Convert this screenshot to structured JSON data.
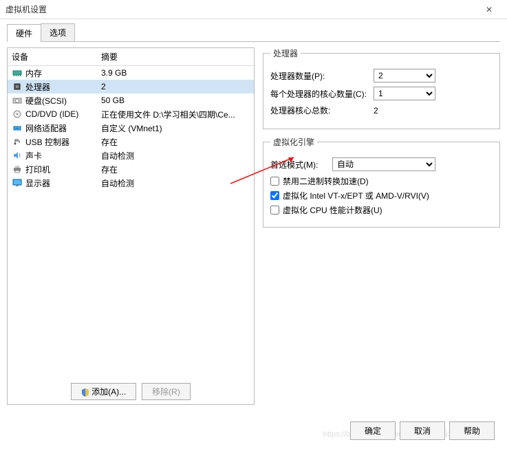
{
  "window": {
    "title": "虚拟机设置"
  },
  "tabs": {
    "hardware": "硬件",
    "options": "选项"
  },
  "device_table": {
    "col_device": "设备",
    "col_summary": "摘要"
  },
  "devices": [
    {
      "icon": "memory-icon",
      "name": "内存",
      "summary": "3.9 GB",
      "selected": false
    },
    {
      "icon": "cpu-icon",
      "name": "处理器",
      "summary": "2",
      "selected": true
    },
    {
      "icon": "disk-icon",
      "name": "硬盘(SCSI)",
      "summary": "50 GB",
      "selected": false
    },
    {
      "icon": "cd-icon",
      "name": "CD/DVD (IDE)",
      "summary": "正在使用文件 D:\\学习相关\\四期\\Ce...",
      "selected": false
    },
    {
      "icon": "net-icon",
      "name": "网络适配器",
      "summary": "自定义 (VMnet1)",
      "selected": false
    },
    {
      "icon": "usb-icon",
      "name": "USB 控制器",
      "summary": "存在",
      "selected": false
    },
    {
      "icon": "sound-icon",
      "name": "声卡",
      "summary": "自动检测",
      "selected": false
    },
    {
      "icon": "printer-icon",
      "name": "打印机",
      "summary": "存在",
      "selected": false
    },
    {
      "icon": "display-icon",
      "name": "显示器",
      "summary": "自动检测",
      "selected": false
    }
  ],
  "left_buttons": {
    "add": "添加(A)...",
    "remove": "移除(R)"
  },
  "processor": {
    "legend": "处理器",
    "count_label": "处理器数量(P):",
    "count_value": "2",
    "cores_label": "每个处理器的核心数量(C):",
    "cores_value": "1",
    "total_label": "处理器核心总数:",
    "total_value": "2"
  },
  "virtualization": {
    "legend": "虚拟化引擎",
    "mode_label": "首选模式(M):",
    "mode_value": "自动",
    "cb1": {
      "label": "禁用二进制转换加速(D)",
      "checked": false
    },
    "cb2": {
      "label": "虚拟化 Intel VT-x/EPT 或 AMD-V/RVI(V)",
      "checked": true
    },
    "cb3": {
      "label": "虚拟化 CPU 性能计数器(U)",
      "checked": false
    }
  },
  "bottom": {
    "ok": "确定",
    "cancel": "取消",
    "help": "帮助"
  },
  "watermark": "https://blog.csdn.net/weixin_45998292"
}
